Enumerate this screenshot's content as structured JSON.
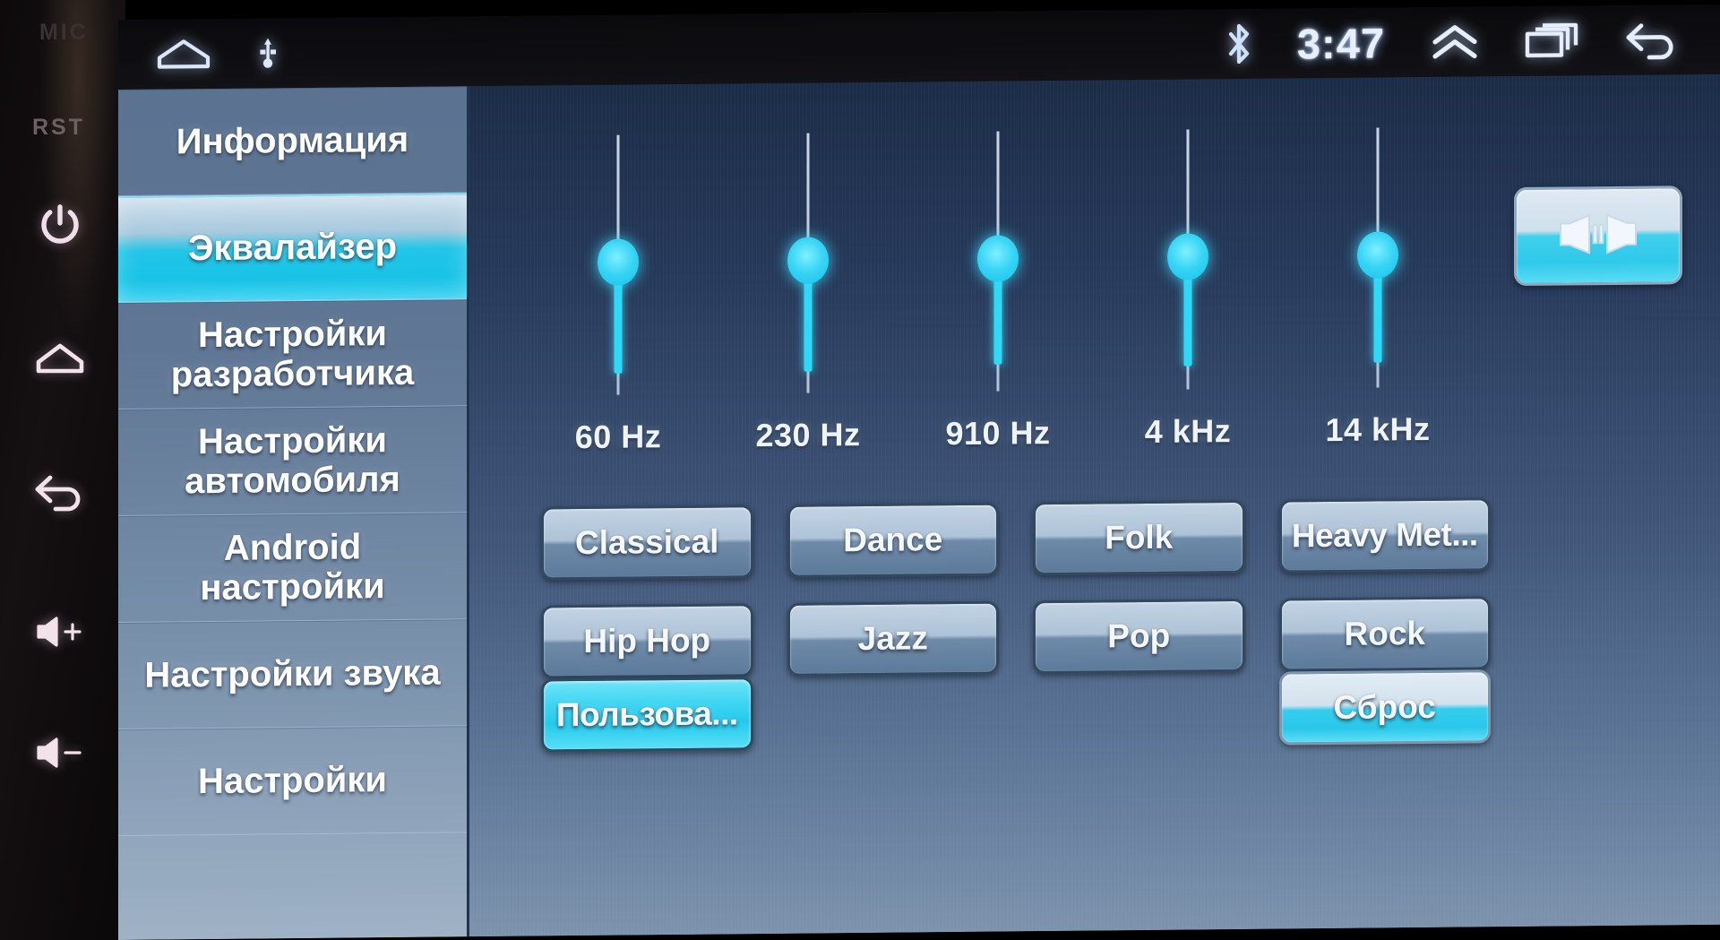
{
  "bezel": {
    "labels": [
      {
        "name": "mic-label",
        "text": "MIC"
      },
      {
        "name": "rst-label",
        "text": "RST"
      }
    ],
    "buttons": [
      {
        "icon": "power-icon",
        "label": "Power"
      },
      {
        "icon": "home-icon",
        "label": "Home"
      },
      {
        "icon": "back-icon",
        "label": "Back"
      },
      {
        "icon": "volume-up-icon",
        "label": "Volume Up"
      },
      {
        "icon": "volume-down-icon",
        "label": "Volume Down"
      }
    ]
  },
  "statusbar": {
    "left_icons": [
      "home-icon",
      "usb-icon"
    ],
    "bluetooth_icon": "bluetooth-icon",
    "clock": "3:47",
    "right_icons": [
      "chevron-double-up-icon",
      "recent-apps-icon",
      "back-arrow-icon"
    ]
  },
  "sidebar": {
    "items": [
      {
        "label": "Информация",
        "active": false
      },
      {
        "label": "Эквалайзер",
        "active": true
      },
      {
        "label": "Настройки\nразработчика",
        "active": false
      },
      {
        "label": "Настройки\nавтомобиля",
        "active": false
      },
      {
        "label": "Android\nнастройки",
        "active": false
      },
      {
        "label": "Настройки звука",
        "active": false
      },
      {
        "label": "Настройки",
        "active": false
      }
    ]
  },
  "main": {
    "balance_button": {
      "icon": "balance-fader-icon",
      "label": "Balance / Fader"
    },
    "equalizer": {
      "bands": [
        {
          "label": "60 Hz",
          "value": 0
        },
        {
          "label": "230 Hz",
          "value": 0
        },
        {
          "label": "910 Hz",
          "value": 0
        },
        {
          "label": "4 kHz",
          "value": 0
        },
        {
          "label": "14 kHz",
          "value": 0
        }
      ],
      "min": -10,
      "max": 10
    },
    "presets": [
      {
        "label": "Classical",
        "selected": false
      },
      {
        "label": "Dance",
        "selected": false
      },
      {
        "label": "Folk",
        "selected": false
      },
      {
        "label": "Heavy Met...",
        "selected": false
      },
      {
        "label": "Hip Hop",
        "selected": false
      },
      {
        "label": "Jazz",
        "selected": false
      },
      {
        "label": "Pop",
        "selected": false
      },
      {
        "label": "Rock",
        "selected": false
      }
    ],
    "user_preset": {
      "label": "Пользова...",
      "selected": true
    },
    "reset_button": {
      "label": "Сброс"
    }
  },
  "colors": {
    "accent_cyan": "#2fd8f7",
    "panel_blue": "#41577a",
    "sidebar_blue": "#6f87a5",
    "text_white": "#ffffff"
  }
}
